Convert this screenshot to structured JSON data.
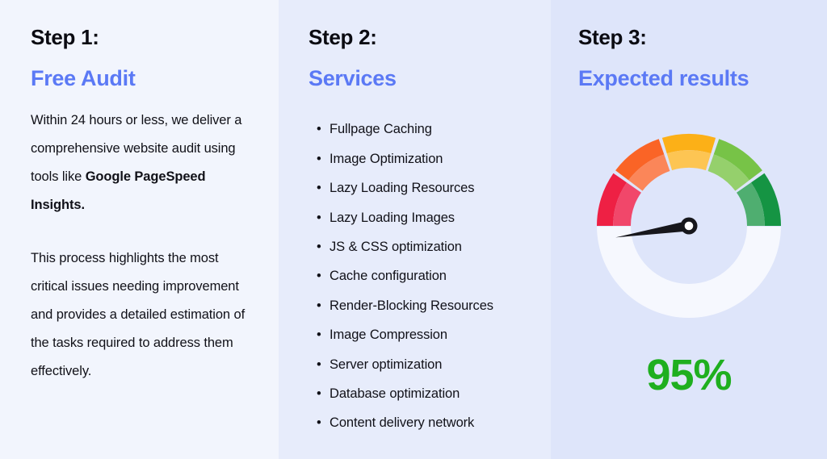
{
  "theme": {
    "col1_bg": "#F2F5FD",
    "col2_bg": "#E7ECFB",
    "col3_bg": "#DEE5FA",
    "accent_blue": "#5B79F5",
    "text_dark": "#111118",
    "score_green": "#1FAF1F"
  },
  "columns": {
    "step1": {
      "label": "Step 1:",
      "title": "Free Audit",
      "paragraph_1_lead": "Within 24 hours or less, we deliver a comprehensive website audit using tools like ",
      "paragraph_1_bold": "Google PageSpeed Insights.",
      "paragraph_2": "This process highlights the most critical issues needing improvement and provides a detailed estimation of the tasks required to address them effectively."
    },
    "step2": {
      "label": "Step 2:",
      "title": "Services",
      "bullet": "•",
      "services": [
        "Fullpage Caching",
        "Image Optimization",
        "Lazy Loading Resources",
        "Lazy Loading Images",
        "JS & CSS optimization",
        "Cache configuration",
        "Render-Blocking Resources",
        "Image Compression",
        "Server optimization",
        "Database optimization",
        "Content delivery network"
      ]
    },
    "step3": {
      "label": "Step 3:",
      "title": "Expected results",
      "score": "95%"
    }
  },
  "chart_data": {
    "type": "gauge",
    "title": "Expected results",
    "value": 95,
    "unit": "%",
    "min": 0,
    "max": 100,
    "value_label": "95%",
    "needle_angle_deg": 171,
    "arc_start_deg": 180,
    "arc_end_deg": 360,
    "segments": [
      {
        "name": "very-poor",
        "from": 0,
        "to": 20,
        "outer_color": "#EE2044",
        "inner_color": "#F1476A"
      },
      {
        "name": "poor",
        "from": 20,
        "to": 40,
        "outer_color": "#FA6426",
        "inner_color": "#FB8659"
      },
      {
        "name": "average",
        "from": 40,
        "to": 60,
        "outer_color": "#FCB017",
        "inner_color": "#FDC553"
      },
      {
        "name": "good",
        "from": 60,
        "to": 80,
        "outer_color": "#77C347",
        "inner_color": "#95D06C"
      },
      {
        "name": "excellent",
        "from": 80,
        "to": 100,
        "outer_color": "#159443",
        "inner_color": "#4FAE70"
      }
    ],
    "track_color": "#F6F8FE",
    "needle_color": "#17171C",
    "legend": [],
    "grid": false
  }
}
